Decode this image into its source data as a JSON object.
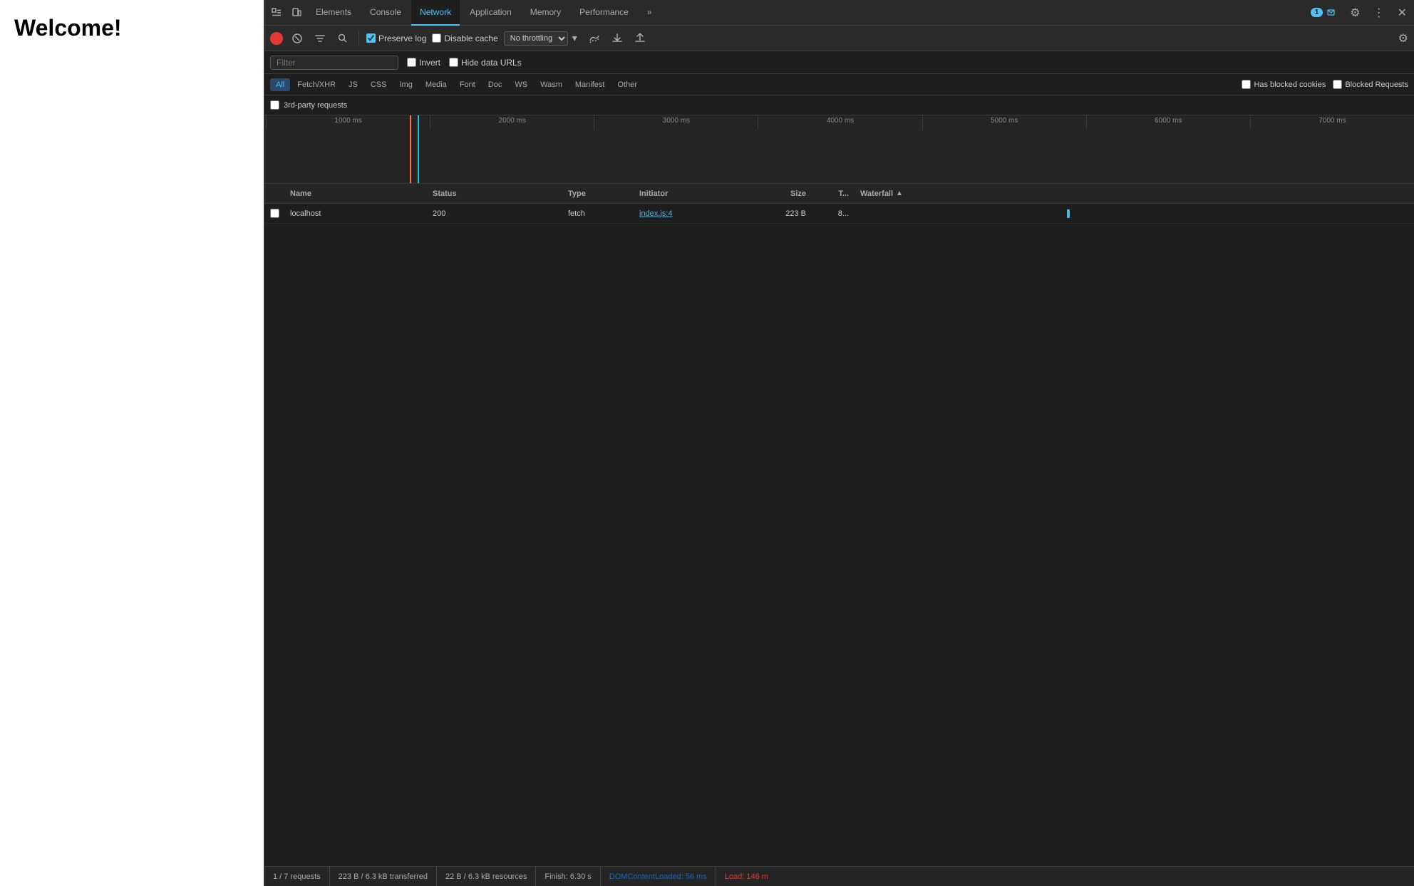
{
  "page": {
    "title": "Welcome!"
  },
  "devtools": {
    "tabs": [
      {
        "id": "elements",
        "label": "Elements",
        "active": false
      },
      {
        "id": "console",
        "label": "Console",
        "active": false
      },
      {
        "id": "network",
        "label": "Network",
        "active": true
      },
      {
        "id": "application",
        "label": "Application",
        "active": false
      },
      {
        "id": "memory",
        "label": "Memory",
        "active": false
      },
      {
        "id": "performance",
        "label": "Performance",
        "active": false
      }
    ],
    "badge_count": "1",
    "toolbar": {
      "preserve_log_label": "Preserve log",
      "disable_cache_label": "Disable cache",
      "throttle_value": "No throttling",
      "preserve_log_checked": true,
      "disable_cache_checked": false
    },
    "filter": {
      "placeholder": "Filter",
      "invert_label": "Invert",
      "hide_data_urls_label": "Hide data URLs",
      "invert_checked": false,
      "hide_data_urls_checked": false
    },
    "type_filters": [
      {
        "id": "all",
        "label": "All",
        "active": true
      },
      {
        "id": "fetch-xhr",
        "label": "Fetch/XHR",
        "active": false
      },
      {
        "id": "js",
        "label": "JS",
        "active": false
      },
      {
        "id": "css",
        "label": "CSS",
        "active": false
      },
      {
        "id": "img",
        "label": "Img",
        "active": false
      },
      {
        "id": "media",
        "label": "Media",
        "active": false
      },
      {
        "id": "font",
        "label": "Font",
        "active": false
      },
      {
        "id": "doc",
        "label": "Doc",
        "active": false
      },
      {
        "id": "ws",
        "label": "WS",
        "active": false
      },
      {
        "id": "wasm",
        "label": "Wasm",
        "active": false
      },
      {
        "id": "manifest",
        "label": "Manifest",
        "active": false
      },
      {
        "id": "other",
        "label": "Other",
        "active": false
      }
    ],
    "extra_filters": {
      "has_blocked_cookies_label": "Has blocked cookies",
      "blocked_requests_label": "Blocked Requests",
      "has_blocked_cookies_checked": false,
      "blocked_requests_checked": false
    },
    "third_party": {
      "label": "3rd-party requests",
      "checked": false
    },
    "timeline": {
      "ticks": [
        "1000 ms",
        "2000 ms",
        "3000 ms",
        "4000 ms",
        "5000 ms",
        "6000 ms",
        "7000 ms"
      ]
    },
    "table": {
      "columns": [
        {
          "id": "name",
          "label": "Name"
        },
        {
          "id": "status",
          "label": "Status"
        },
        {
          "id": "type",
          "label": "Type"
        },
        {
          "id": "initiator",
          "label": "Initiator"
        },
        {
          "id": "size",
          "label": "Size"
        },
        {
          "id": "time",
          "label": "T..."
        },
        {
          "id": "waterfall",
          "label": "Waterfall"
        }
      ],
      "rows": [
        {
          "name": "localhost",
          "status": "200",
          "type": "fetch",
          "initiator": "index.js:4",
          "size": "223 B",
          "time": "8..."
        }
      ]
    },
    "statusbar": {
      "requests": "1 / 7 requests",
      "transferred": "223 B / 6.3 kB transferred",
      "resources": "22 B / 6.3 kB resources",
      "finish": "Finish: 6.30 s",
      "domcontentloaded": "DOMContentLoaded: 56 ms",
      "load": "Load: 146 m"
    }
  }
}
